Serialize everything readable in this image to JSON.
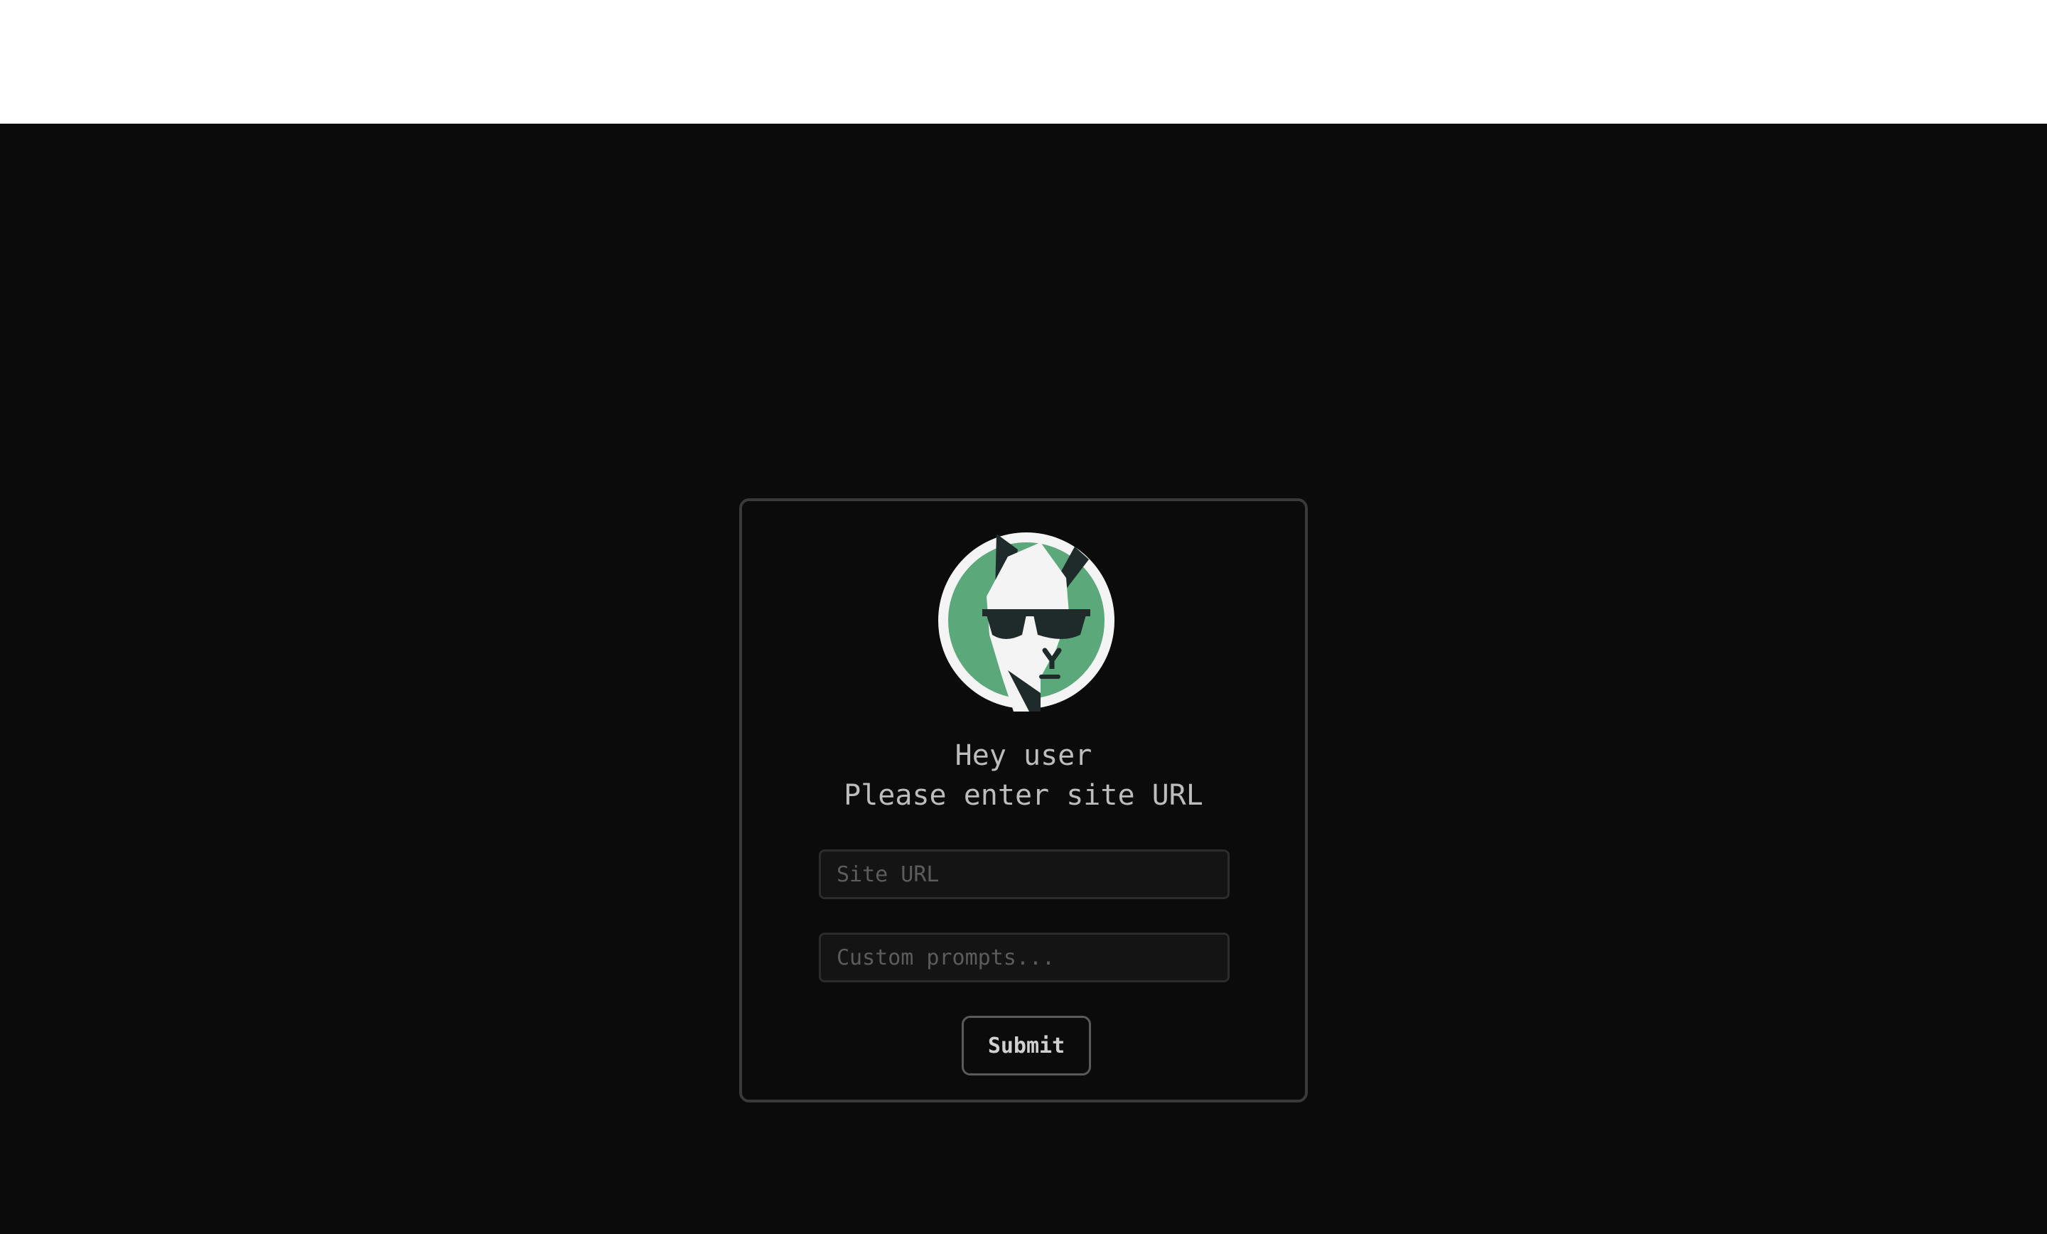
{
  "page": {
    "background": "#0b0b0b",
    "top_strip_color": "#ffffff"
  },
  "card": {
    "avatar_icon": "llama-with-sunglasses-logo",
    "avatar_colors": {
      "circle": "#5ba87a",
      "face": "#f4f4f4",
      "dark": "#1f2a2a"
    },
    "greeting": "Hey user",
    "prompt": "Please enter site URL"
  },
  "form": {
    "site_url": {
      "value": "",
      "placeholder": "Site URL"
    },
    "custom_prompts": {
      "value": "",
      "placeholder": "Custom prompts..."
    },
    "submit_label": "Submit"
  }
}
